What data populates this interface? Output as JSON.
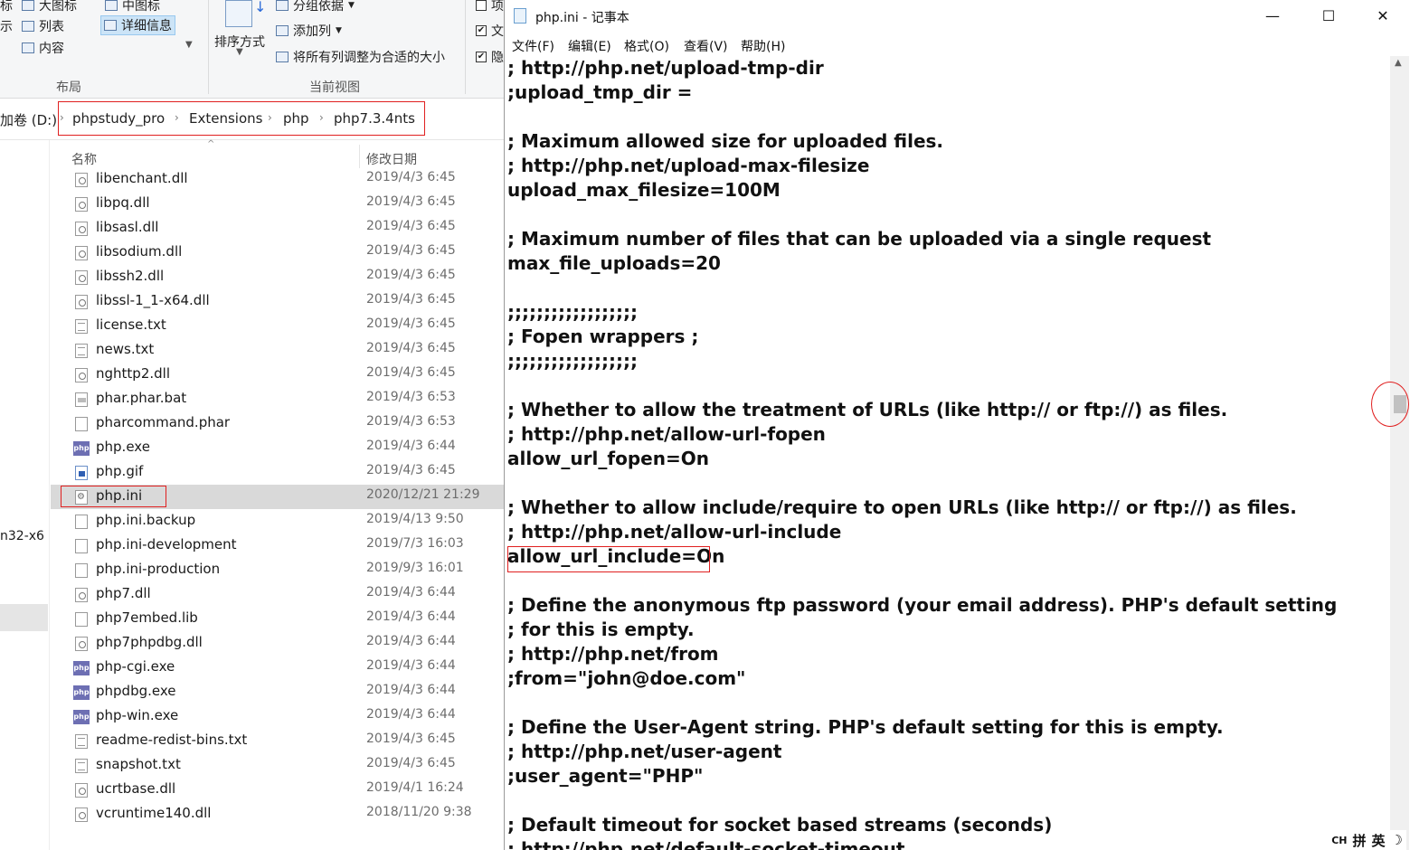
{
  "explorer": {
    "ribbon": {
      "view_items": {
        "large_icons_frag": "标",
        "large_icons": "大图标",
        "medium_icons": "中图标",
        "list_frag": "示",
        "list": "列表",
        "details": "详细信息",
        "content": "内容"
      },
      "layout_group": "布局",
      "sort_by": "排序方式",
      "group_by": "分组依据",
      "add_column": "添加列",
      "size_all_columns": "将所有列调整为合适的大小",
      "current_view_group": "当前视图",
      "checkbox_frag1": "项",
      "checkbox_frag2": "文",
      "checkbox_frag3": "隐"
    },
    "address": {
      "drive": "加卷 (D:)",
      "crumbs": [
        "phpstudy_pro",
        "Extensions",
        "php",
        "php7.3.4nts"
      ]
    },
    "nav_fragment": "n32-x6",
    "columns": {
      "name": "名称",
      "date": "修改日期"
    },
    "files": [
      {
        "name": "libenchant.dll",
        "date": "2019/4/3 6:45",
        "icon": "dll"
      },
      {
        "name": "libpq.dll",
        "date": "2019/4/3 6:45",
        "icon": "dll"
      },
      {
        "name": "libsasl.dll",
        "date": "2019/4/3 6:45",
        "icon": "dll"
      },
      {
        "name": "libsodium.dll",
        "date": "2019/4/3 6:45",
        "icon": "dll"
      },
      {
        "name": "libssh2.dll",
        "date": "2019/4/3 6:45",
        "icon": "dll"
      },
      {
        "name": "libssl-1_1-x64.dll",
        "date": "2019/4/3 6:45",
        "icon": "dll"
      },
      {
        "name": "license.txt",
        "date": "2019/4/3 6:45",
        "icon": "txt"
      },
      {
        "name": "news.txt",
        "date": "2019/4/3 6:45",
        "icon": "txt"
      },
      {
        "name": "nghttp2.dll",
        "date": "2019/4/3 6:45",
        "icon": "dll"
      },
      {
        "name": "phar.phar.bat",
        "date": "2019/4/3 6:53",
        "icon": "bat"
      },
      {
        "name": "pharcommand.phar",
        "date": "2019/4/3 6:53",
        "icon": "file"
      },
      {
        "name": "php.exe",
        "date": "2019/4/3 6:44",
        "icon": "phpexe"
      },
      {
        "name": "php.gif",
        "date": "2019/4/3 6:45",
        "icon": "gif"
      },
      {
        "name": "php.ini",
        "date": "2020/12/21 21:29",
        "icon": "ini",
        "selected": true
      },
      {
        "name": "php.ini.backup",
        "date": "2019/4/13 9:50",
        "icon": "file"
      },
      {
        "name": "php.ini-development",
        "date": "2019/7/3 16:03",
        "icon": "file"
      },
      {
        "name": "php.ini-production",
        "date": "2019/9/3 16:01",
        "icon": "file"
      },
      {
        "name": "php7.dll",
        "date": "2019/4/3 6:44",
        "icon": "dll"
      },
      {
        "name": "php7embed.lib",
        "date": "2019/4/3 6:44",
        "icon": "file"
      },
      {
        "name": "php7phpdbg.dll",
        "date": "2019/4/3 6:44",
        "icon": "dll"
      },
      {
        "name": "php-cgi.exe",
        "date": "2019/4/3 6:44",
        "icon": "phpexe"
      },
      {
        "name": "phpdbg.exe",
        "date": "2019/4/3 6:44",
        "icon": "phpexe"
      },
      {
        "name": "php-win.exe",
        "date": "2019/4/3 6:44",
        "icon": "phpexe"
      },
      {
        "name": "readme-redist-bins.txt",
        "date": "2019/4/3 6:45",
        "icon": "txt"
      },
      {
        "name": "snapshot.txt",
        "date": "2019/4/3 6:45",
        "icon": "txt"
      },
      {
        "name": "ucrtbase.dll",
        "date": "2019/4/1 16:24",
        "icon": "dll"
      },
      {
        "name": "vcruntime140.dll",
        "date": "2018/11/20 9:38",
        "icon": "dll"
      }
    ],
    "php_exe_icon_text": "php"
  },
  "notepad": {
    "title": "php.ini - 记事本",
    "window_buttons": {
      "minimize": "—",
      "maximize": "☐",
      "close": "✕"
    },
    "menu": [
      "文件(F)",
      "编辑(E)",
      "格式(O)",
      "查看(V)",
      "帮助(H)"
    ],
    "lines": [
      "; http://php.net/upload-tmp-dir",
      ";upload_tmp_dir =",
      "",
      "; Maximum allowed size for uploaded files.",
      "; http://php.net/upload-max-filesize",
      "upload_max_filesize=100M",
      "",
      "; Maximum number of files that can be uploaded via a single request",
      "max_file_uploads=20",
      "",
      ";;;;;;;;;;;;;;;;;;",
      "; Fopen wrappers ;",
      ";;;;;;;;;;;;;;;;;;",
      "",
      "; Whether to allow the treatment of URLs (like http:// or ftp://) as files.",
      "; http://php.net/allow-url-fopen",
      "allow_url_fopen=On",
      "",
      "; Whether to allow include/require to open URLs (like http:// or ftp://) as files.",
      "; http://php.net/allow-url-include",
      "allow_url_include=On",
      "",
      "; Define the anonymous ftp password (your email address). PHP's default setting",
      "; for this is empty.",
      "; http://php.net/from",
      ";from=\"john@doe.com\"",
      "",
      "; Define the User-Agent string. PHP's default setting for this is empty.",
      "; http://php.net/user-agent",
      ";user_agent=\"PHP\"",
      "",
      "; Default timeout for socket based streams (seconds)",
      "; http://php.net/default-socket-timeout"
    ],
    "tray": {
      "lang": "CH",
      "ime1": "拼",
      "ime2": "英",
      "moon": "☽"
    },
    "scroll_up": "▲"
  }
}
